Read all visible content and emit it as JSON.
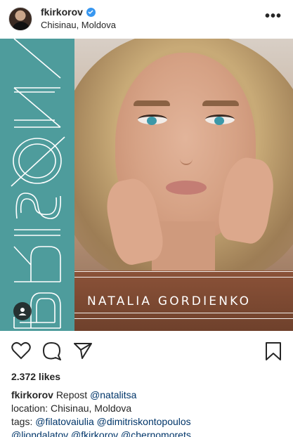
{
  "header": {
    "username": "fkirkorov",
    "location": "Chisinau, Moldova",
    "more_label": "•••"
  },
  "post": {
    "cover_title": "PRISØN",
    "artist_name": "NATALIA GORDIENKO",
    "colors": {
      "teal": "#4e9c9c"
    }
  },
  "actions": {
    "icons": [
      "heart-icon",
      "comment-icon",
      "share-icon",
      "bookmark-icon"
    ]
  },
  "likes": "2.372 likes",
  "caption": {
    "username": "fkirkorov",
    "text": "Repost",
    "mention": "@natalitsa",
    "location_line": "location: Chisinau, Moldova",
    "tags_prefix": "tags:",
    "tag1": "@filatovaiulia",
    "tag2": "@dimitriskontopoulos",
    "clipped_line": "@liondalatov @fkirkorov @chernomorets..."
  }
}
